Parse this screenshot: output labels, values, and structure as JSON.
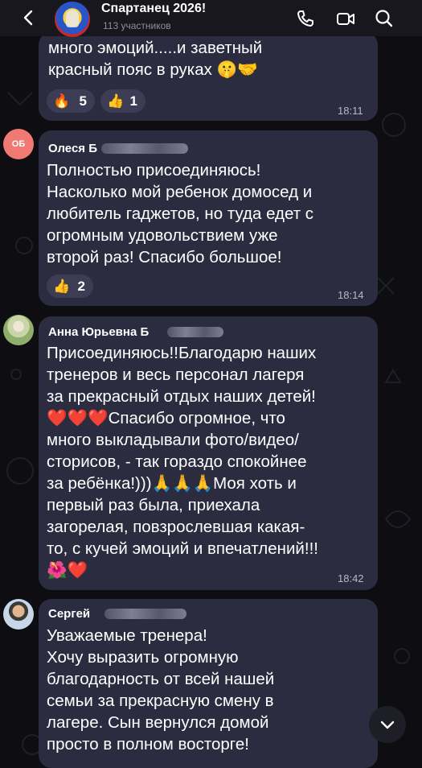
{
  "header": {
    "title": "Спартанец 2026!",
    "subtitle": "113 участников"
  },
  "messages": [
    {
      "text": "много эмоций.....и заветный\nкрасный пояс в руках 🤫🤝",
      "reactions": [
        {
          "emoji": "🔥",
          "count": "5"
        },
        {
          "emoji": "👍",
          "count": "1"
        }
      ],
      "time": "18:11"
    },
    {
      "author": "Олеся Б",
      "avatar_initials": "ОБ",
      "text": "Полностью присоединяюсь!\nНасколько мой ребенок домосед и\nлюбитель гаджетов, но туда едет с\nогромным удовольствием уже\nвторой раз! Спасибо большое!",
      "reactions": [
        {
          "emoji": "👍",
          "count": "2"
        }
      ],
      "time": "18:14"
    },
    {
      "author": "Анна Юрьевна Б",
      "text": "Присоединяюсь!!Благодарю наших\nтренеров и весь персонал лагеря\nза прекрасный отдых наших детей!\n❤️❤️❤️Спасибо огромное, что\nмного выкладывали фото/видео/\nсторисов, - так гораздо спокойнее\nза ребёнка!)))🙏🙏🙏Моя хоть и\nпервый раз была, приехала\nзагорелая, повзрослевшая какая-\nто, с кучей эмоций и впечатлений!!!\n🌺❤️",
      "time": "18:42"
    },
    {
      "author": "Сергей",
      "text": "Уважаемые тренера!\nХочу выразить огромную\nблагодарность от всей нашей\nсемьи за прекрасную смену в\nлагере. Сын вернулся домой\nпросто в полном восторге!"
    }
  ],
  "icons": {
    "back": "back-arrow-icon",
    "call": "phone-icon",
    "video": "video-camera-icon",
    "search": "search-icon",
    "scroll": "chevron-down-icon"
  },
  "colors": {
    "bubble": "#2b2c3f",
    "reaction": "#3c3d55",
    "header": "#17171d",
    "background": "#0d0d12"
  }
}
